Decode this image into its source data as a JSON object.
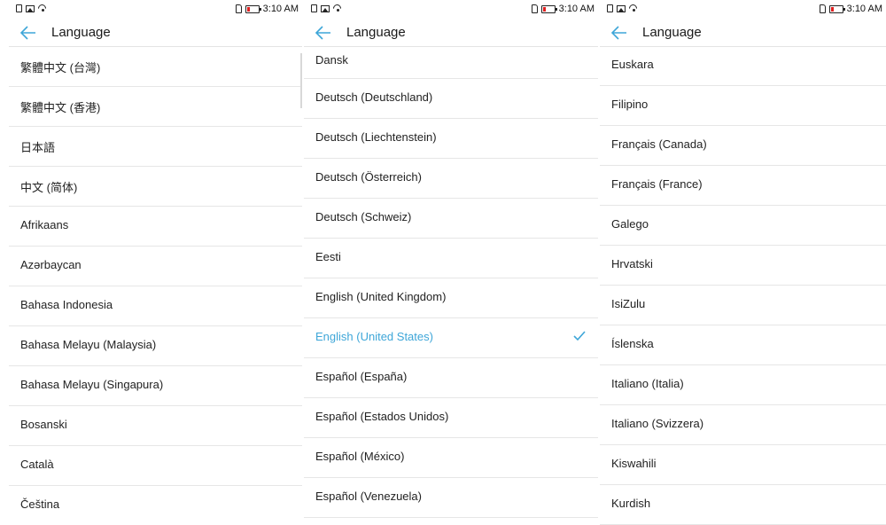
{
  "panels": [
    {
      "status": {
        "time": "3:10 AM"
      },
      "title": "Language",
      "items": [
        {
          "label": "繁體中文 (台灣)"
        },
        {
          "label": "繁體中文 (香港)"
        },
        {
          "label": "日本語"
        },
        {
          "label": "中文 (简体)"
        },
        {
          "label": "Afrikaans"
        },
        {
          "label": "Azərbaycan"
        },
        {
          "label": "Bahasa Indonesia"
        },
        {
          "label": "Bahasa Melayu (Malaysia)"
        },
        {
          "label": "Bahasa Melayu (Singapura)"
        },
        {
          "label": "Bosanski"
        },
        {
          "label": "Català"
        },
        {
          "label": "Čeština"
        }
      ]
    },
    {
      "status": {
        "time": "3:10 AM"
      },
      "title": "Language",
      "items": [
        {
          "label": "Dansk"
        },
        {
          "label": "Deutsch (Deutschland)"
        },
        {
          "label": "Deutsch (Liechtenstein)"
        },
        {
          "label": "Deutsch (Österreich)"
        },
        {
          "label": "Deutsch (Schweiz)"
        },
        {
          "label": "Eesti"
        },
        {
          "label": "English (United Kingdom)"
        },
        {
          "label": "English (United States)",
          "selected": true
        },
        {
          "label": "Español (España)"
        },
        {
          "label": "Español (Estados Unidos)"
        },
        {
          "label": "Español (México)"
        },
        {
          "label": "Español (Venezuela)"
        }
      ]
    },
    {
      "status": {
        "time": "3:10 AM"
      },
      "title": "Language",
      "items": [
        {
          "label": "Euskara"
        },
        {
          "label": "Filipino"
        },
        {
          "label": "Français (Canada)"
        },
        {
          "label": "Français (France)"
        },
        {
          "label": "Galego"
        },
        {
          "label": "Hrvatski"
        },
        {
          "label": "IsiZulu"
        },
        {
          "label": "Íslenska"
        },
        {
          "label": "Italiano (Italia)"
        },
        {
          "label": "Italiano (Svizzera)"
        },
        {
          "label": "Kiswahili"
        },
        {
          "label": "Kurdish"
        }
      ]
    }
  ],
  "colors": {
    "accent": "#3ea6d8",
    "text": "#222222",
    "divider": "#e6e6e6",
    "battery_low": "#e02020"
  },
  "icons": {
    "back": "arrow-left-icon",
    "selected": "checkmark-icon"
  }
}
